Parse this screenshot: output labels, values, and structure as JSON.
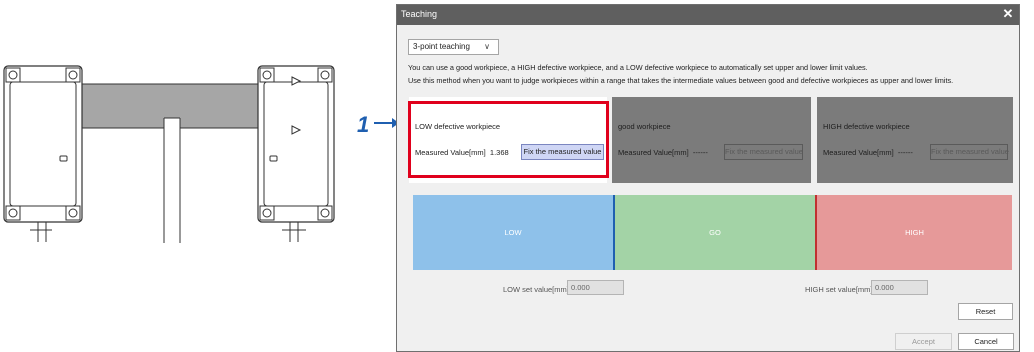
{
  "step": {
    "number": "1"
  },
  "dialog": {
    "title": "Teaching",
    "close_glyph": "✕",
    "mode_select": {
      "value": "3-point teaching",
      "chevron": "∨"
    },
    "description_line1": "You can use a good workpiece, a HIGH defective workpiece, and a LOW defective workpiece to automatically set upper and lower limit values.",
    "description_line2": "Use this method when you want to judge workpieces within a range that takes the intermediate values between good and defective workpieces as upper and lower limits.",
    "panels": {
      "low": {
        "title": "LOW defective workpiece",
        "label": "Measured Value[mm]",
        "value": "1.368",
        "button": "Fix the measured value"
      },
      "good": {
        "title": "good workpiece",
        "label": "Measured Value[mm]",
        "value": "------",
        "button": "Fix the measured value"
      },
      "high": {
        "title": "HIGH defective workpiece",
        "label": "Measured Value[mm]",
        "value": "------",
        "button": "Fix the measured value"
      }
    },
    "zones": {
      "low": "LOW",
      "go": "GO",
      "high": "HIGH"
    },
    "low_set": {
      "label": "LOW set value[mm]",
      "value": "0.000"
    },
    "high_set": {
      "label": "HIGH set value[mm]",
      "value": "0.000"
    },
    "buttons": {
      "reset": "Reset",
      "accept": "Accept",
      "cancel": "Cancel"
    }
  },
  "colors": {
    "highlight": "#e0001c",
    "step_marker": "#1f5fb0",
    "zone_low": "#8ec1ea",
    "zone_go": "#a3d3a6",
    "zone_high": "#e69999"
  }
}
